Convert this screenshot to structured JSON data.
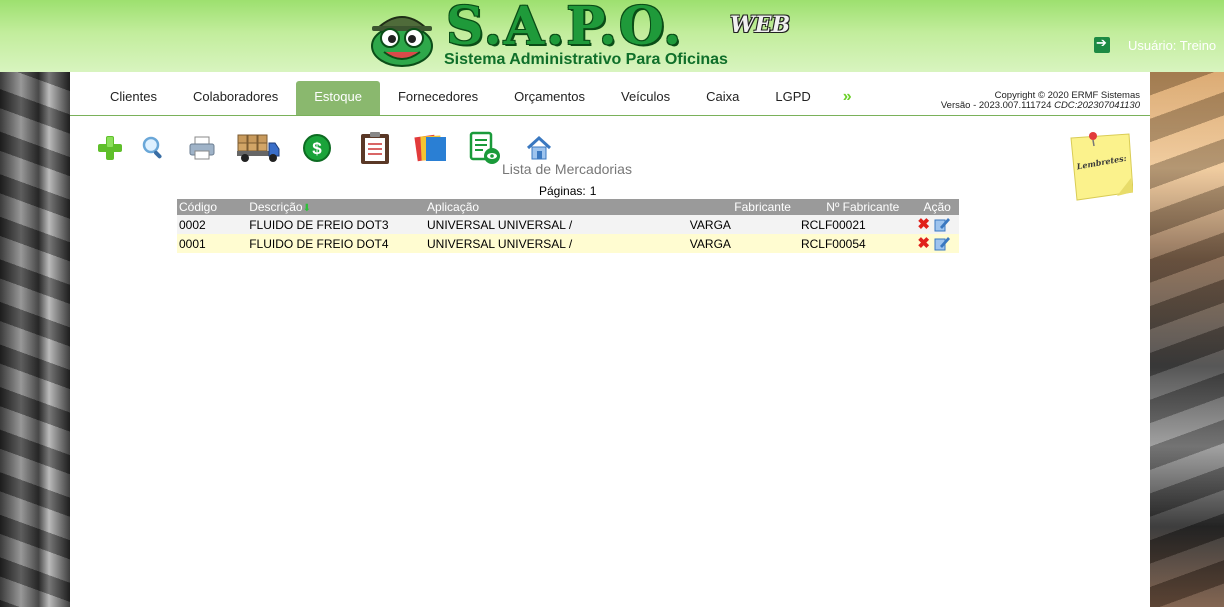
{
  "header": {
    "logo_title": "S.A.P.O.",
    "logo_badge": "WEB",
    "logo_subtitle": "Sistema Administrativo Para Oficinas",
    "user_label": "Usuário: Treino"
  },
  "nav": {
    "items": [
      "Clientes",
      "Colaboradores",
      "Estoque",
      "Fornecedores",
      "Orçamentos",
      "Veículos",
      "Caixa",
      "LGPD"
    ],
    "active": "Estoque",
    "more": "»"
  },
  "copyright": {
    "line1": "Copyright © 2020 ERMF Sistemas",
    "version_prefix": "Versão - 2023.007.111724",
    "cdc": "CDC:202307041130"
  },
  "toolbar": {
    "icons": [
      "add-icon",
      "search-icon",
      "print-icon",
      "truck-icon",
      "dollar-icon",
      "clipboard-icon",
      "folders-icon",
      "report-view-icon",
      "home-icon"
    ]
  },
  "lembretes_label": "Lembretes:",
  "list": {
    "title": "Lista de Mercadorias",
    "pages_label": "Páginas:",
    "pages_value": "1",
    "columns": [
      "Código",
      "Descrição",
      "Aplicação",
      "Fabricante",
      "Nº Fabricante",
      "Ação"
    ],
    "rows": [
      {
        "codigo": "0002",
        "descricao": "FLUIDO DE FREIO DOT3",
        "aplicacao": "UNIVERSAL UNIVERSAL /",
        "fabricante": "VARGA",
        "n_fabricante": "RCLF00021"
      },
      {
        "codigo": "0001",
        "descricao": "FLUIDO DE FREIO DOT4",
        "aplicacao": "UNIVERSAL UNIVERSAL /",
        "fabricante": "VARGA",
        "n_fabricante": "RCLF00054"
      }
    ]
  },
  "colors": {
    "header_green": "#9de06f",
    "active_tab": "#8ab86e",
    "table_header": "#9a9a9a",
    "row_alt": "#fffcd1"
  }
}
